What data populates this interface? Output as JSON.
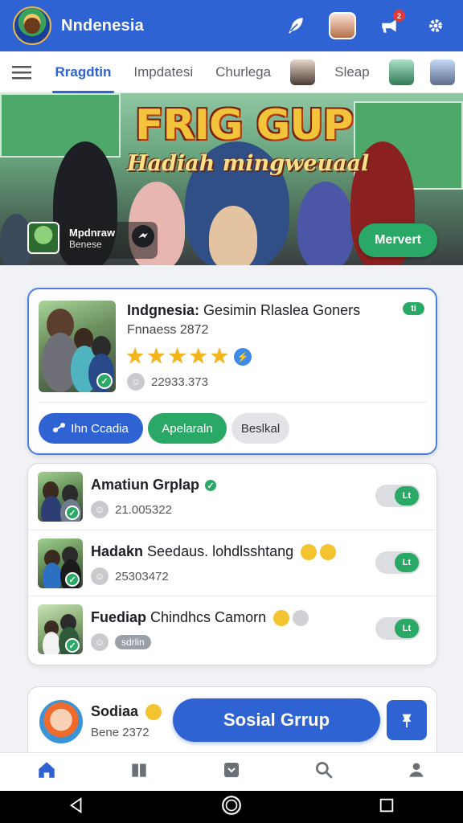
{
  "appbar": {
    "title": "Nndenesia",
    "icons": [
      "feather-icon",
      "profile-avatar",
      "notification-icon",
      "settings-icon"
    ],
    "notification_count": "2"
  },
  "tabs": [
    {
      "label": "Rragdtin",
      "active": true
    },
    {
      "label": "Impdatesi",
      "active": false
    },
    {
      "label": "Churlega",
      "active": false
    },
    {
      "label": "Sleap",
      "active": false
    }
  ],
  "hero": {
    "title": "FRIG GUP",
    "subtitle": "Hadiah mingweuaal",
    "card_title": "Mpdnraw",
    "card_sub": "Benese",
    "cta": "Mervert"
  },
  "featured": {
    "title_bold": "Indgnesia:",
    "title_rest": " Gesimin Rlaslea Goners",
    "subtitle": "Fnnaess 2872",
    "rating": 5,
    "stat": "22933.373",
    "tag": "ti",
    "buttons": {
      "primary": "Ihn Ccadia",
      "secondary": "Apelaraln",
      "tertiary": "Beslkal"
    }
  },
  "groups": [
    {
      "title_bold": "Amatiun Grplap",
      "title_rest": "",
      "meta": "21.005322",
      "toggle": "Lt"
    },
    {
      "title_bold": "Hadakn",
      "title_rest": " Seedaus. lohdlsshtang",
      "meta": "25303472",
      "toggle": "Lt"
    },
    {
      "title_bold": "Fuediap",
      "title_rest": " Chindhcs Camorn",
      "meta": "sdrlin",
      "toggle": "Lt"
    }
  ],
  "user": {
    "name": "Sodiaa",
    "sub": "Bene 2372",
    "button": "Sosial Grrup"
  },
  "colors": {
    "primary": "#2f63d3",
    "accent_green": "#2aa866",
    "star": "#f3b51a"
  }
}
